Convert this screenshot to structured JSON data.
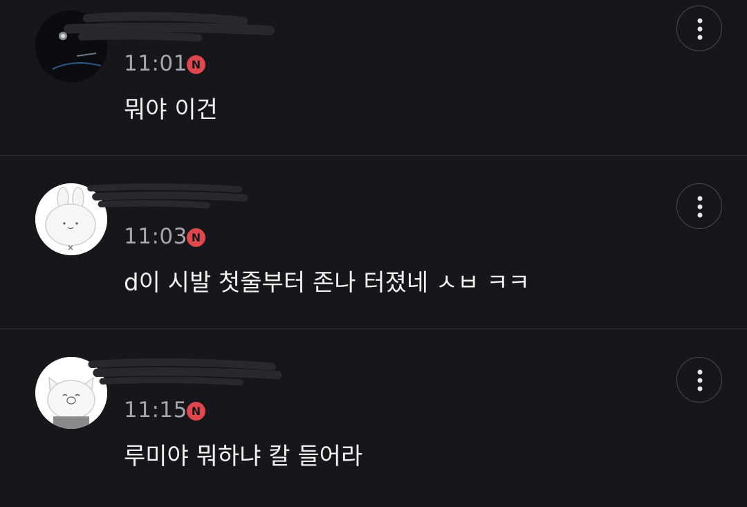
{
  "comments": [
    {
      "time": "11:01",
      "badge": "N",
      "text": "뭐야 이건",
      "avatar": "dark-photo-avatar",
      "more_icon": "vertical-dots-icon"
    },
    {
      "time": "11:03",
      "badge": "N",
      "text": "d이 시발 첫줄부터 존나 터졌네 ㅅㅂ ㅋㅋ",
      "avatar": "bunny-character-avatar",
      "more_icon": "vertical-dots-icon"
    },
    {
      "time": "11:15",
      "badge": "N",
      "text": "루미야 뭐하냐 칼 들어라",
      "avatar": "cat-character-avatar",
      "more_icon": "vertical-dots-icon"
    }
  ],
  "colors": {
    "background": "#17171b",
    "divider": "#313136",
    "time_text": "#a7a7ad",
    "body_text": "#f2f2f2",
    "badge": "#e0474c"
  }
}
